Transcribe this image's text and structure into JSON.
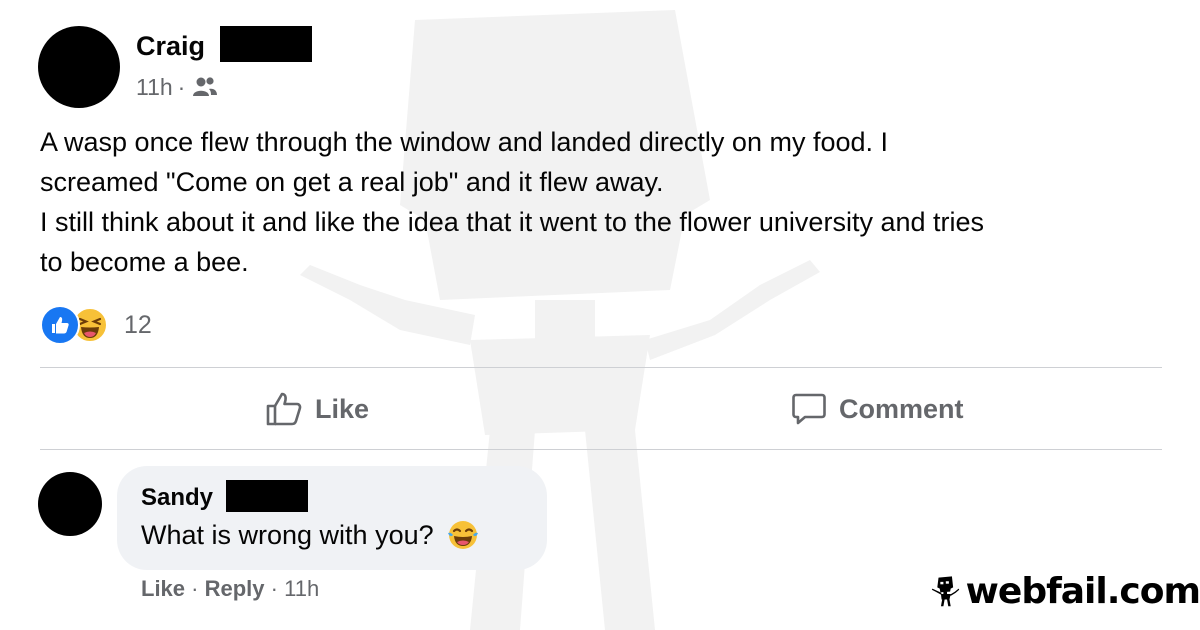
{
  "post": {
    "author": "Craig",
    "time": "11h",
    "separator": "·",
    "audience_icon": "friends-icon",
    "body": [
      "A wasp once flew through the window and landed directly on my food. I",
      "screamed \"Come on get a real job\" and it flew away.",
      "I still think about it and like the idea that it went to the flower university and tries",
      "to become a bee."
    ],
    "reactions": {
      "icons": [
        "like-reaction-icon",
        "haha-reaction-icon"
      ],
      "count": "12"
    }
  },
  "actions": {
    "like_label": "Like",
    "comment_label": "Comment"
  },
  "comment": {
    "author": "Sandy",
    "text": "What is wrong with you?",
    "emoji_icon": "tears-of-joy-icon",
    "like_label": "Like",
    "reply_label": "Reply",
    "separator": "·",
    "time": "11h"
  },
  "brand": {
    "label": "webfail.com"
  },
  "colors": {
    "text": "#050505",
    "secondary": "#65676b",
    "like_blue": "#1877f2",
    "bubble": "#f0f2f5",
    "divider": "#ced0d4",
    "watermark": "#f2f2f2"
  }
}
